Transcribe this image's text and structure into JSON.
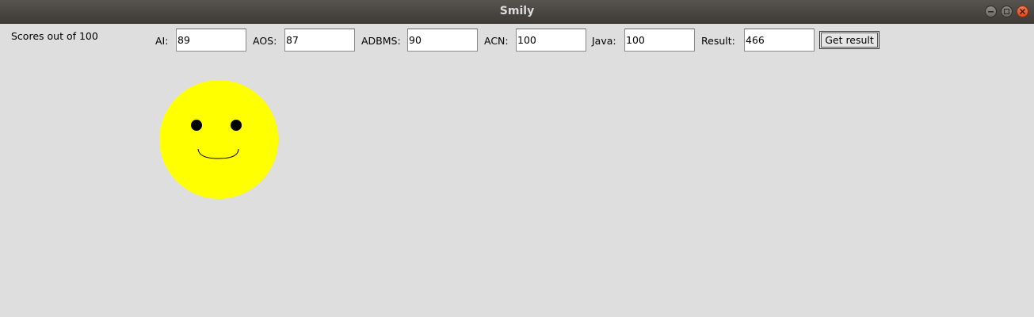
{
  "window": {
    "title": "Smily"
  },
  "header": {
    "scores_label": "Scores out of 100"
  },
  "fields": [
    {
      "label": "AI:",
      "value": "89"
    },
    {
      "label": "AOS:",
      "value": "87"
    },
    {
      "label": "ADBMS:",
      "value": "90"
    },
    {
      "label": "ACN:",
      "value": "100"
    },
    {
      "label": "Java:",
      "value": "100"
    },
    {
      "label": "Result:",
      "value": "466"
    }
  ],
  "actions": {
    "get_result_label": "Get result"
  },
  "colors": {
    "face": "#ffff00",
    "eyes": "#000000",
    "background": "#dedede",
    "titlebar": "#4a4743",
    "close_button": "#e95420"
  },
  "icons": {
    "minimize": "minimize-icon",
    "maximize": "maximize-icon",
    "close": "close-icon"
  }
}
